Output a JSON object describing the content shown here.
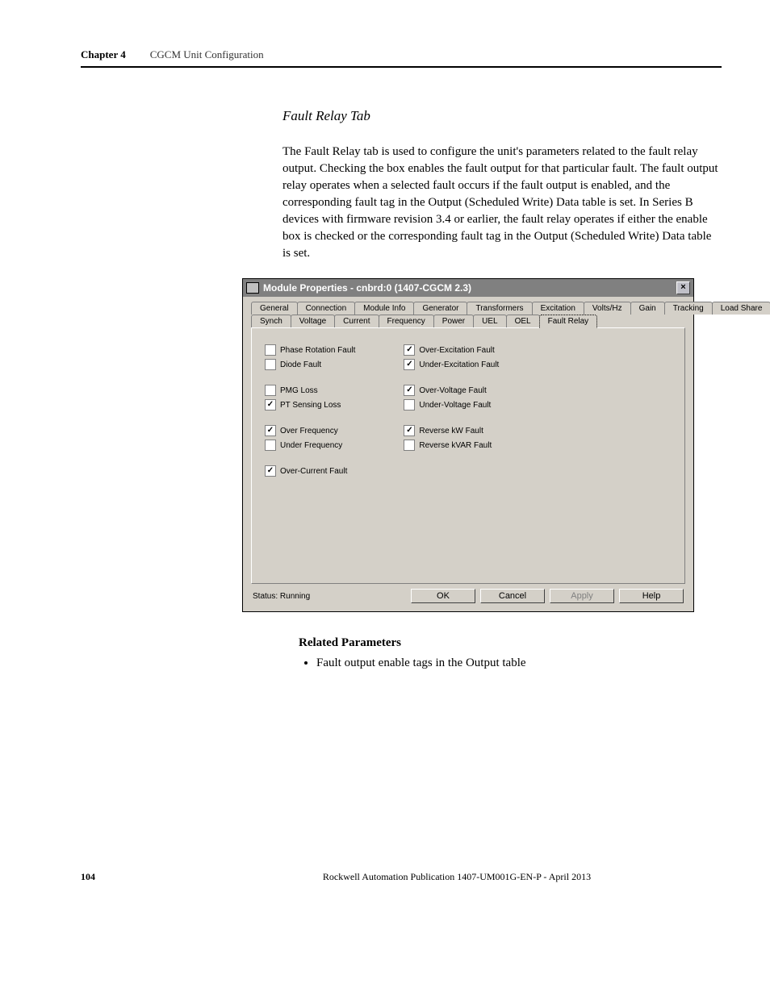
{
  "header": {
    "chapter_label": "Chapter 4",
    "chapter_title": "CGCM Unit Configuration"
  },
  "section": {
    "heading": "Fault Relay Tab",
    "body": "The Fault Relay tab is used to configure the unit's parameters related to the fault relay output. Checking the box enables the fault output for that particular fault. The fault output relay operates when a selected fault occurs if the fault output is enabled, and the corresponding fault tag in the Output (Scheduled Write) Data table is set. In Series B devices with firmware revision 3.4 or earlier, the fault relay operates if either the enable box is checked or the corresponding fault tag in the Output (Scheduled Write) Data table is set."
  },
  "dialog": {
    "title": "Module Properties - cnbrd:0 (1407-CGCM 2.3)",
    "tabs_row1": [
      "General",
      "Connection",
      "Module Info",
      "Generator",
      "Transformers",
      "Excitation",
      "Volts/Hz",
      "Gain",
      "Tracking",
      "Load Share"
    ],
    "tabs_row2": [
      "Synch",
      "Voltage",
      "Current",
      "Frequency",
      "Power",
      "UEL",
      "OEL",
      "Fault Relay"
    ],
    "active_tab": "Fault Relay",
    "faults_col1": [
      [
        {
          "label": "Phase Rotation Fault",
          "checked": false
        },
        {
          "label": "Diode Fault",
          "checked": false
        }
      ],
      [
        {
          "label": "PMG Loss",
          "checked": false
        },
        {
          "label": "PT Sensing Loss",
          "checked": true
        }
      ],
      [
        {
          "label": "Over Frequency",
          "checked": true
        },
        {
          "label": "Under Frequency",
          "checked": false
        }
      ],
      [
        {
          "label": "Over-Current Fault",
          "checked": true
        }
      ]
    ],
    "faults_col2": [
      [
        {
          "label": "Over-Excitation Fault",
          "checked": true
        },
        {
          "label": "Under-Excitation Fault",
          "checked": true
        }
      ],
      [
        {
          "label": "Over-Voltage Fault",
          "checked": true
        },
        {
          "label": "Under-Voltage Fault",
          "checked": false
        }
      ],
      [
        {
          "label": "Reverse kW Fault",
          "checked": true
        },
        {
          "label": "Reverse kVAR Fault",
          "checked": false
        }
      ]
    ],
    "status": "Status:  Running",
    "buttons": {
      "ok": "OK",
      "cancel": "Cancel",
      "apply": "Apply",
      "help": "Help"
    }
  },
  "related": {
    "heading": "Related Parameters",
    "items": [
      "Fault output enable tags in the Output table"
    ]
  },
  "footer": {
    "page": "104",
    "publication": "Rockwell Automation Publication 1407-UM001G-EN-P - April 2013"
  }
}
